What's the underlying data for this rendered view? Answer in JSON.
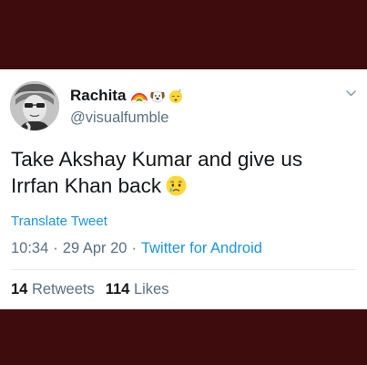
{
  "tweet": {
    "display_name": "Rachita",
    "handle": "@visualfumble",
    "name_emojis": [
      "rainbow-emoji",
      "dog-face-emoji",
      "sleeping-face-emoji"
    ],
    "text_line1": "Take Akshay Kumar and give us",
    "text_line2": "Irrfan Khan back",
    "text_emoji": "crying-face-emoji",
    "translate_label": "Translate Tweet",
    "time": "10:34",
    "separator": "·",
    "date": "29 Apr 20",
    "source": "Twitter for Android",
    "retweets_count": "14",
    "retweets_label": "Retweets",
    "likes_count": "114",
    "likes_label": "Likes"
  },
  "colors": {
    "background": "#3e0c0c",
    "card": "#ffffff",
    "link": "#1b95e0",
    "secondary_text": "#5b7083",
    "primary_text": "#14171a"
  }
}
